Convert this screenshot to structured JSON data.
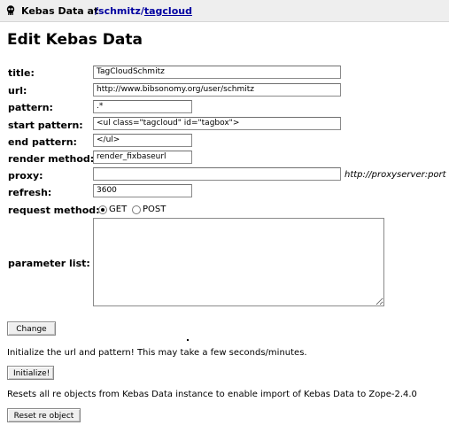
{
  "header": {
    "title": "Kebas Data at",
    "path_sep1": "/",
    "path_part1": "schmitz",
    "path_sep2": "/",
    "path_part2": "tagcloud"
  },
  "page_title": "Edit Kebas Data",
  "form": {
    "title": {
      "label": "title:",
      "value": "TagCloudSchmitz"
    },
    "url": {
      "label": "url:",
      "value": "http://www.bibsonomy.org/user/schmitz"
    },
    "pattern": {
      "label": "pattern:",
      "value": ".*"
    },
    "start": {
      "label": "start pattern:",
      "value": "<ul class=\"tagcloud\" id=\"tagbox\">"
    },
    "end": {
      "label": "end pattern:",
      "value": "</ul>"
    },
    "render": {
      "label": "render method:",
      "value": "render_fixbaseurl"
    },
    "proxy": {
      "label": "proxy:",
      "value": "",
      "hint": "http://proxyserver:port"
    },
    "refresh": {
      "label": "refresh:",
      "value": "3600"
    },
    "request_method": {
      "label": "request method:",
      "options": [
        "GET",
        "POST"
      ],
      "selected": "GET"
    },
    "params": {
      "label": "parameter list:",
      "value": ""
    }
  },
  "buttons": {
    "change": "Change",
    "initialize": "Initialize!",
    "reset": "Reset re object"
  },
  "messages": {
    "init_note": "Initialize the url and pattern! This may take a few seconds/minutes.",
    "reset_note": "Resets all re objects from Kebas Data instance to enable import of Kebas Data to Zope-2.4.0"
  }
}
